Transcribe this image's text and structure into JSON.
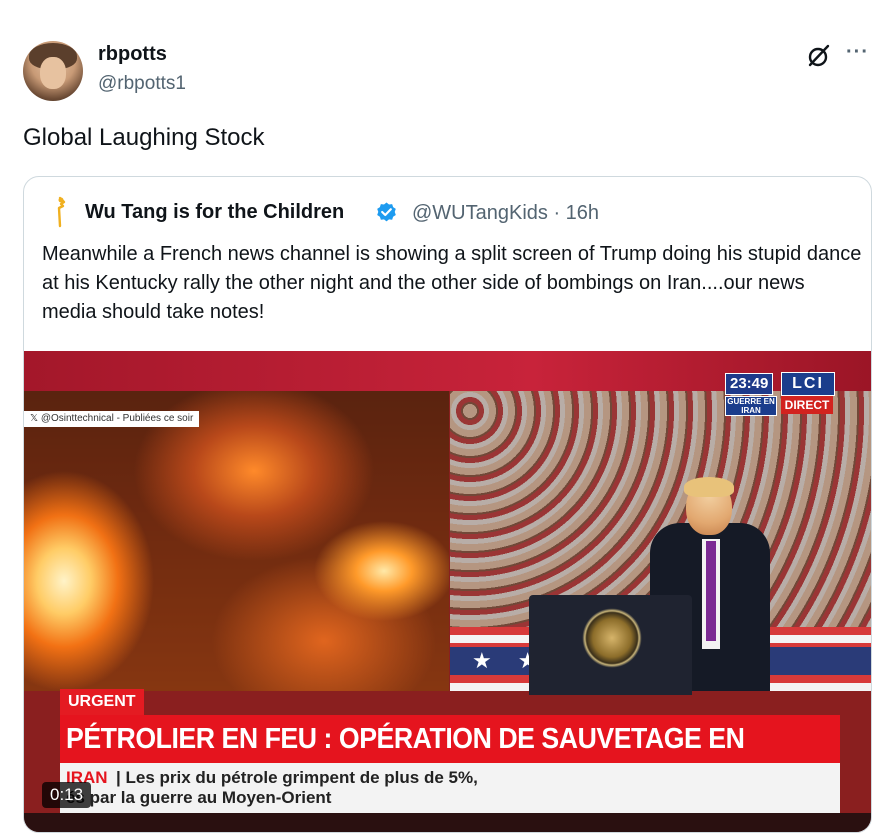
{
  "post": {
    "user_name": "rbpotts",
    "user_handle": "@rbpotts1",
    "text": "Global Laughing Stock",
    "more_label": "···"
  },
  "quote": {
    "user_name": "Wu Tang is for the Children",
    "user_handle_time": "@WUTangKids · 16h",
    "text": "Meanwhile a French news channel is showing a split screen of Trump doing his stupid dance at his Kentucky rally the other night and the other side of bombings on Iran....our news media should take notes!",
    "verified_color": "#1d9bf0"
  },
  "video": {
    "source_tag": "𝕏 @Osinttechnical - Publiées ce soir",
    "clock": "23:49",
    "channel": "LCI",
    "section_tag": "GUERRE EN IRAN",
    "live_label": "DIRECT",
    "urgent_label": "URGENT",
    "headline": "PÉTROLIER EN FEU : OPÉRATION DE SAUVETAGE EN COURS",
    "ticker_topic": "IRAN",
    "ticker_line1": "| Les prix du pétrole grimpent de plus de 5%,",
    "ticker_line2": "és par la guerre au Moyen-Orient",
    "duration": "0:13",
    "banner_stars": "★★★★★★"
  },
  "colors": {
    "text_primary": "#0f1419",
    "text_secondary": "#536471",
    "border": "#cfd9de",
    "news_red": "#e5141e"
  }
}
